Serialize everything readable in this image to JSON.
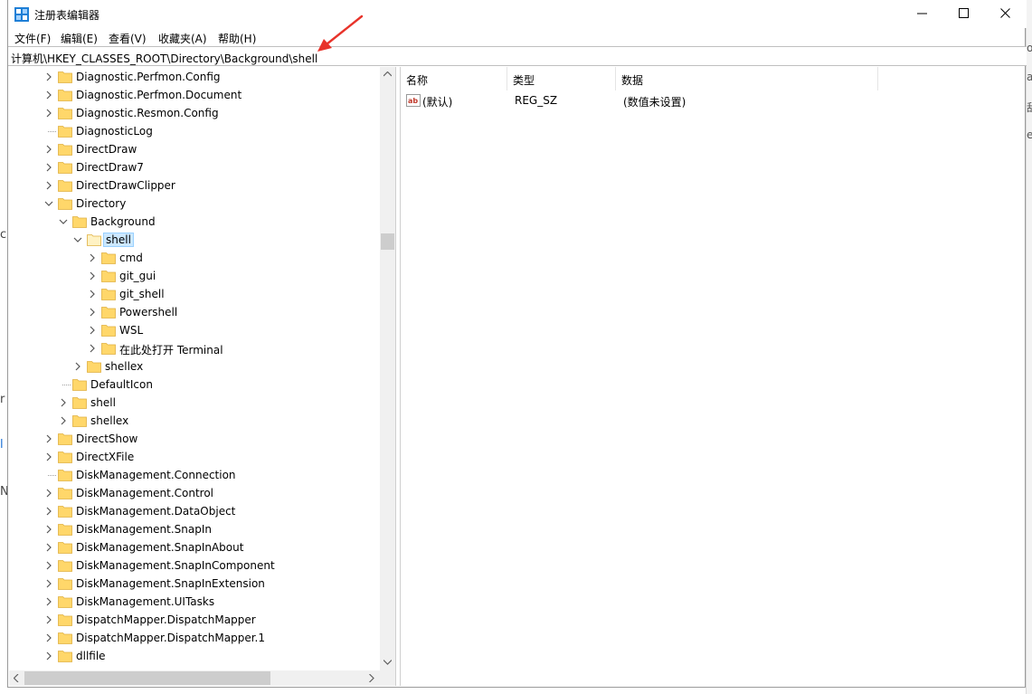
{
  "window": {
    "title": "注册表编辑器"
  },
  "menu": [
    "文件(F)",
    "编辑(E)",
    "查看(V)",
    "收藏夹(A)",
    "帮助(H)"
  ],
  "address": "计算机\\HKEY_CLASSES_ROOT\\Directory\\Background\\shell",
  "tree": [
    {
      "label": "Diagnostic.Perfmon.Config",
      "level": 0,
      "expander": "collapsed"
    },
    {
      "label": "Diagnostic.Perfmon.Document",
      "level": 0,
      "expander": "collapsed"
    },
    {
      "label": "Diagnostic.Resmon.Config",
      "level": 0,
      "expander": "collapsed"
    },
    {
      "label": "DiagnosticLog",
      "level": 0,
      "expander": "none"
    },
    {
      "label": "DirectDraw",
      "level": 0,
      "expander": "collapsed"
    },
    {
      "label": "DirectDraw7",
      "level": 0,
      "expander": "collapsed"
    },
    {
      "label": "DirectDrawClipper",
      "level": 0,
      "expander": "collapsed"
    },
    {
      "label": "Directory",
      "level": 0,
      "expander": "expanded"
    },
    {
      "label": "Background",
      "level": 1,
      "expander": "expanded"
    },
    {
      "label": "shell",
      "level": 2,
      "expander": "expanded",
      "selected": true
    },
    {
      "label": "cmd",
      "level": 3,
      "expander": "collapsed"
    },
    {
      "label": "git_gui",
      "level": 3,
      "expander": "collapsed"
    },
    {
      "label": "git_shell",
      "level": 3,
      "expander": "collapsed"
    },
    {
      "label": "Powershell",
      "level": 3,
      "expander": "collapsed"
    },
    {
      "label": "WSL",
      "level": 3,
      "expander": "collapsed"
    },
    {
      "label": "在此处打开 Terminal",
      "level": 3,
      "expander": "collapsed"
    },
    {
      "label": "shellex",
      "level": 2,
      "expander": "collapsed"
    },
    {
      "label": "DefaultIcon",
      "level": 1,
      "expander": "none"
    },
    {
      "label": "shell",
      "level": 1,
      "expander": "collapsed"
    },
    {
      "label": "shellex",
      "level": 1,
      "expander": "collapsed"
    },
    {
      "label": "DirectShow",
      "level": 0,
      "expander": "collapsed"
    },
    {
      "label": "DirectXFile",
      "level": 0,
      "expander": "collapsed"
    },
    {
      "label": "DiskManagement.Connection",
      "level": 0,
      "expander": "none"
    },
    {
      "label": "DiskManagement.Control",
      "level": 0,
      "expander": "collapsed"
    },
    {
      "label": "DiskManagement.DataObject",
      "level": 0,
      "expander": "collapsed"
    },
    {
      "label": "DiskManagement.SnapIn",
      "level": 0,
      "expander": "collapsed"
    },
    {
      "label": "DiskManagement.SnapInAbout",
      "level": 0,
      "expander": "collapsed"
    },
    {
      "label": "DiskManagement.SnapInComponent",
      "level": 0,
      "expander": "collapsed"
    },
    {
      "label": "DiskManagement.SnapInExtension",
      "level": 0,
      "expander": "collapsed"
    },
    {
      "label": "DiskManagement.UITasks",
      "level": 0,
      "expander": "collapsed"
    },
    {
      "label": "DispatchMapper.DispatchMapper",
      "level": 0,
      "expander": "collapsed"
    },
    {
      "label": "DispatchMapper.DispatchMapper.1",
      "level": 0,
      "expander": "collapsed"
    },
    {
      "label": "dllfile",
      "level": 0,
      "expander": "collapsed"
    }
  ],
  "columns": [
    "名称",
    "类型",
    "数据"
  ],
  "values": [
    {
      "name": "(默认)",
      "type": "REG_SZ",
      "data": "(数值未设置)"
    }
  ],
  "colors": {
    "selection": "#cce8ff",
    "folder": "#ffd76a",
    "arrow": "#e8332a"
  }
}
